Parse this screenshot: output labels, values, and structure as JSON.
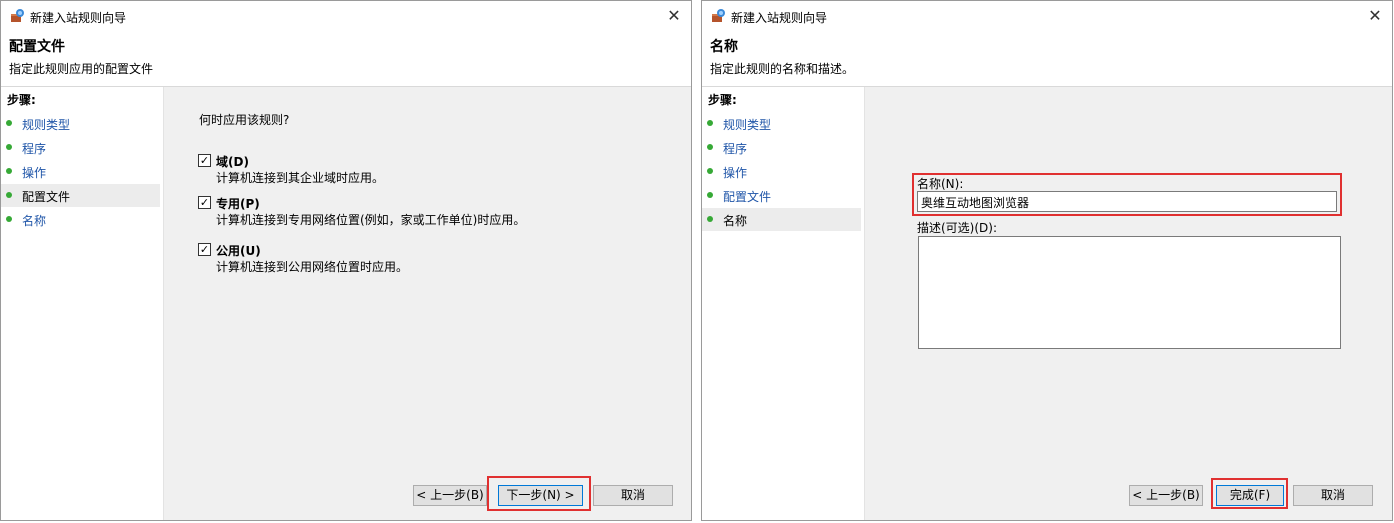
{
  "window1": {
    "title": "新建入站规则向导",
    "header_title": "配置文件",
    "header_subtitle": "指定此规则应用的配置文件",
    "steps_header": "步骤:",
    "steps": [
      {
        "label": "规则类型"
      },
      {
        "label": "程序"
      },
      {
        "label": "操作"
      },
      {
        "label": "配置文件",
        "current": true
      },
      {
        "label": "名称"
      }
    ],
    "question": "何时应用该规则?",
    "options": [
      {
        "label": "域(D)",
        "desc": "计算机连接到其企业域时应用。",
        "checked": true
      },
      {
        "label": "专用(P)",
        "desc": "计算机连接到专用网络位置(例如，家或工作单位)时应用。",
        "checked": true
      },
      {
        "label": "公用(U)",
        "desc": "计算机连接到公用网络位置时应用。",
        "checked": true
      }
    ],
    "buttons": {
      "back": "< 上一步(B)",
      "next": "下一步(N) >",
      "cancel": "取消"
    },
    "close_glyph": "✕"
  },
  "window2": {
    "title": "新建入站规则向导",
    "header_title": "名称",
    "header_subtitle": "指定此规则的名称和描述。",
    "steps_header": "步骤:",
    "steps": [
      {
        "label": "规则类型"
      },
      {
        "label": "程序"
      },
      {
        "label": "操作"
      },
      {
        "label": "配置文件"
      },
      {
        "label": "名称",
        "current": true
      }
    ],
    "name_label": "名称(N):",
    "name_value": "奥维互动地图浏览器",
    "desc_label": "描述(可选)(D):",
    "desc_value": "",
    "buttons": {
      "back": "< 上一步(B)",
      "finish": "完成(F)",
      "cancel": "取消"
    },
    "close_glyph": "✕"
  },
  "colors": {
    "step_dot": "#36a936",
    "step_link": "#1f55a8",
    "highlight": "#e03030",
    "primary_border": "#0078d7"
  }
}
